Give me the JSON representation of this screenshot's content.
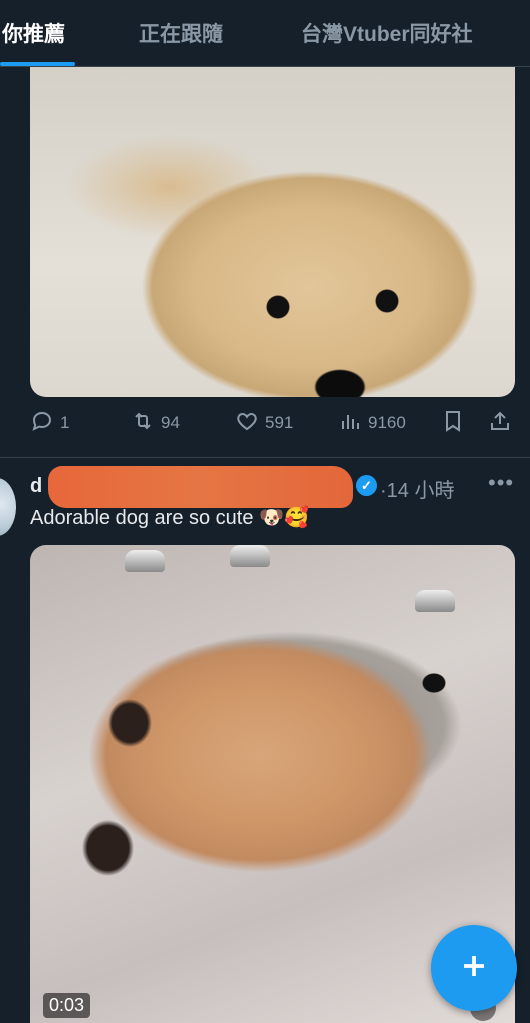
{
  "tabs": [
    {
      "label": "你推薦",
      "active": true
    },
    {
      "label": "正在跟隨",
      "active": false
    },
    {
      "label": "台灣Vtuber同好社",
      "active": false
    }
  ],
  "post1": {
    "image": "puppy-lying-on-floor",
    "actions": {
      "reply_count": "1",
      "retweet_count": "94",
      "like_count": "591",
      "view_count": "9160"
    }
  },
  "post2": {
    "handle_visible": "d",
    "time": "·14 小時",
    "text": "Adorable dog are so cute 🐶🥰",
    "video": "puppy-in-sink",
    "video_time": "0:03"
  },
  "colors": {
    "background": "#15202b",
    "accent": "#1d9bf0",
    "muted": "#8b98a5",
    "redaction": "#f07a45"
  },
  "icons": [
    "reply-icon",
    "retweet-icon",
    "like-icon",
    "views-icon",
    "bookmark-icon",
    "share-icon",
    "verified-badge-icon",
    "more-icon",
    "compose-icon"
  ]
}
